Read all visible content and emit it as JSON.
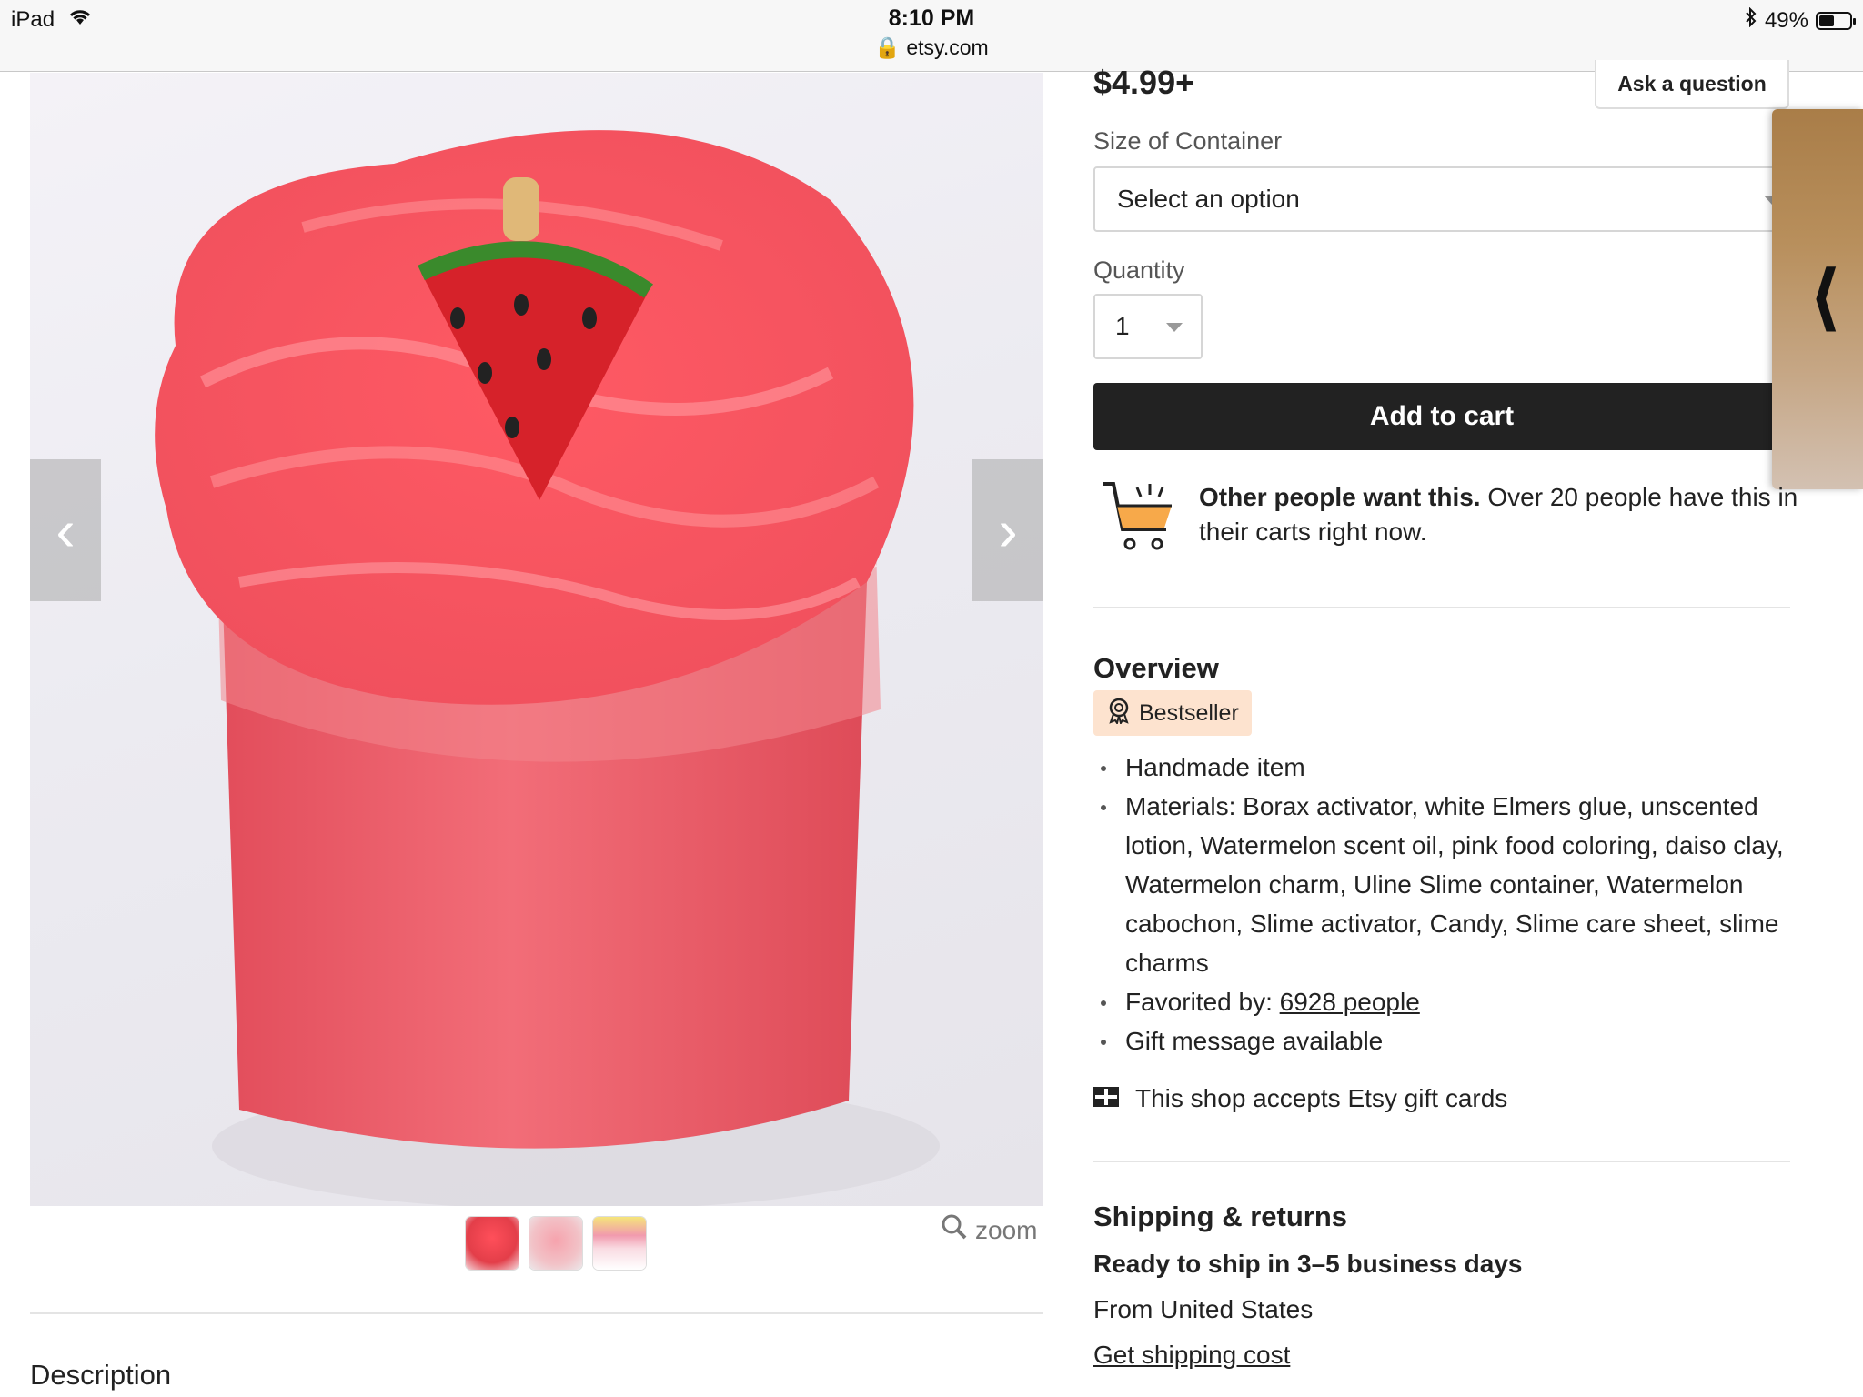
{
  "status_bar": {
    "device": "iPad",
    "time": "8:10 PM",
    "url": "etsy.com",
    "battery": "49%",
    "battery_level": 0.49
  },
  "gallery": {
    "prev_icon": "chevron-left-icon",
    "next_icon": "chevron-right-icon",
    "zoom_label": "zoom",
    "thumbnail_count": 3
  },
  "listing": {
    "price": "$4.99+",
    "ask_question": "Ask a question",
    "size_label": "Size of Container",
    "size_placeholder": "Select an option",
    "quantity_label": "Quantity",
    "quantity_value": "1",
    "add_to_cart": "Add to cart",
    "demand_bold": "Other people want this.",
    "demand_text": " Over 20 people have this in their carts right now."
  },
  "overview": {
    "title": "Overview",
    "badge": "Bestseller",
    "handmade": "Handmade item",
    "materials": "Materials: Borax activator, white Elmers glue, unscented lotion, Watermelon scent oil, pink food coloring, daiso clay, Watermelon charm, Uline Slime container, Watermelon cabochon, Slime activator, Candy, Slime care sheet, slime charms",
    "favorited_prefix": "Favorited by: ",
    "favorited_link": "6928 people",
    "gift_message": "Gift message available",
    "gift_cards": "This shop accepts Etsy gift cards"
  },
  "shipping": {
    "title": "Shipping & returns",
    "ready": "Ready to ship in 3–5 business days",
    "from": "From United States",
    "cost_link": "Get shipping cost"
  },
  "description": {
    "title": "Description"
  },
  "colors": {
    "button_dark": "#222222",
    "badge_bg": "#fde3cf",
    "cart_orange": "#f7a94a",
    "slime_pink": "#f0626c"
  }
}
